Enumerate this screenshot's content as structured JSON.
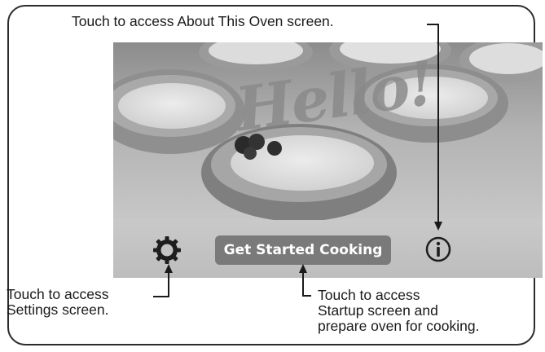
{
  "annotations": {
    "about": "Touch to access About This Oven screen.",
    "settings": "Touch to access\nSettings screen.",
    "startup": "Touch to access\nStartup screen and\nprepare oven for cooking."
  },
  "screen": {
    "greeting": "Hello!",
    "start_button": "Get Started Cooking"
  },
  "icons": {
    "settings": "gear-icon",
    "about": "info-icon"
  },
  "colors": {
    "button_bg": "#7a7a7a",
    "bar_bg": "#c3c3c3",
    "greeting": "#8a8a8a"
  }
}
